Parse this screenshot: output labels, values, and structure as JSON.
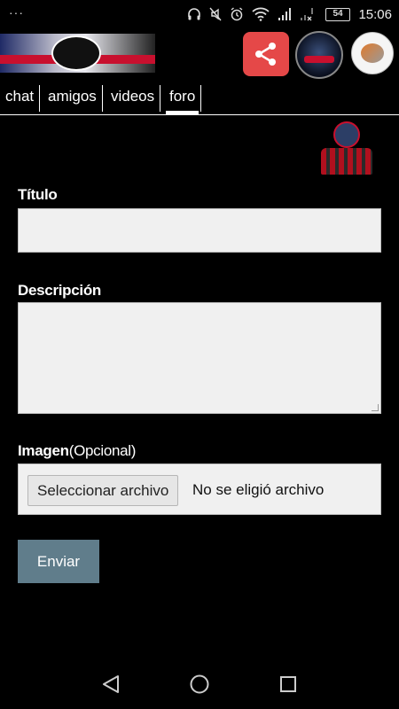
{
  "status_bar": {
    "overflow_dots": "···",
    "icons": [
      "headphones-icon",
      "mute-icon",
      "alarm-icon",
      "wifi-icon",
      "signal-icon",
      "signal-no-sim-icon"
    ],
    "battery": "54",
    "time": "15:06"
  },
  "app_bar": {
    "logo": "club-logo-banner",
    "actions": [
      "share-icon",
      "team-crest-icon",
      "futbol-app-icon"
    ]
  },
  "tabs": [
    {
      "label": "chat"
    },
    {
      "label": "amigos"
    },
    {
      "label": "videos"
    },
    {
      "label": "foro",
      "active": true
    }
  ],
  "form": {
    "title_label": "Título",
    "title_value": "",
    "description_label": "Descripción",
    "description_value": "",
    "image_label": "Imagen",
    "image_optional": "(Opcional)",
    "file_button": "Seleccionar archivo",
    "file_status": "No se eligió archivo",
    "submit_label": "Enviar"
  },
  "colors": {
    "background": "#000000",
    "submit_button": "#607d8b",
    "share_button": "#e54848",
    "field_background": "#f0f0f0"
  },
  "nav_bar": [
    "back-icon",
    "home-icon",
    "recents-icon"
  ]
}
